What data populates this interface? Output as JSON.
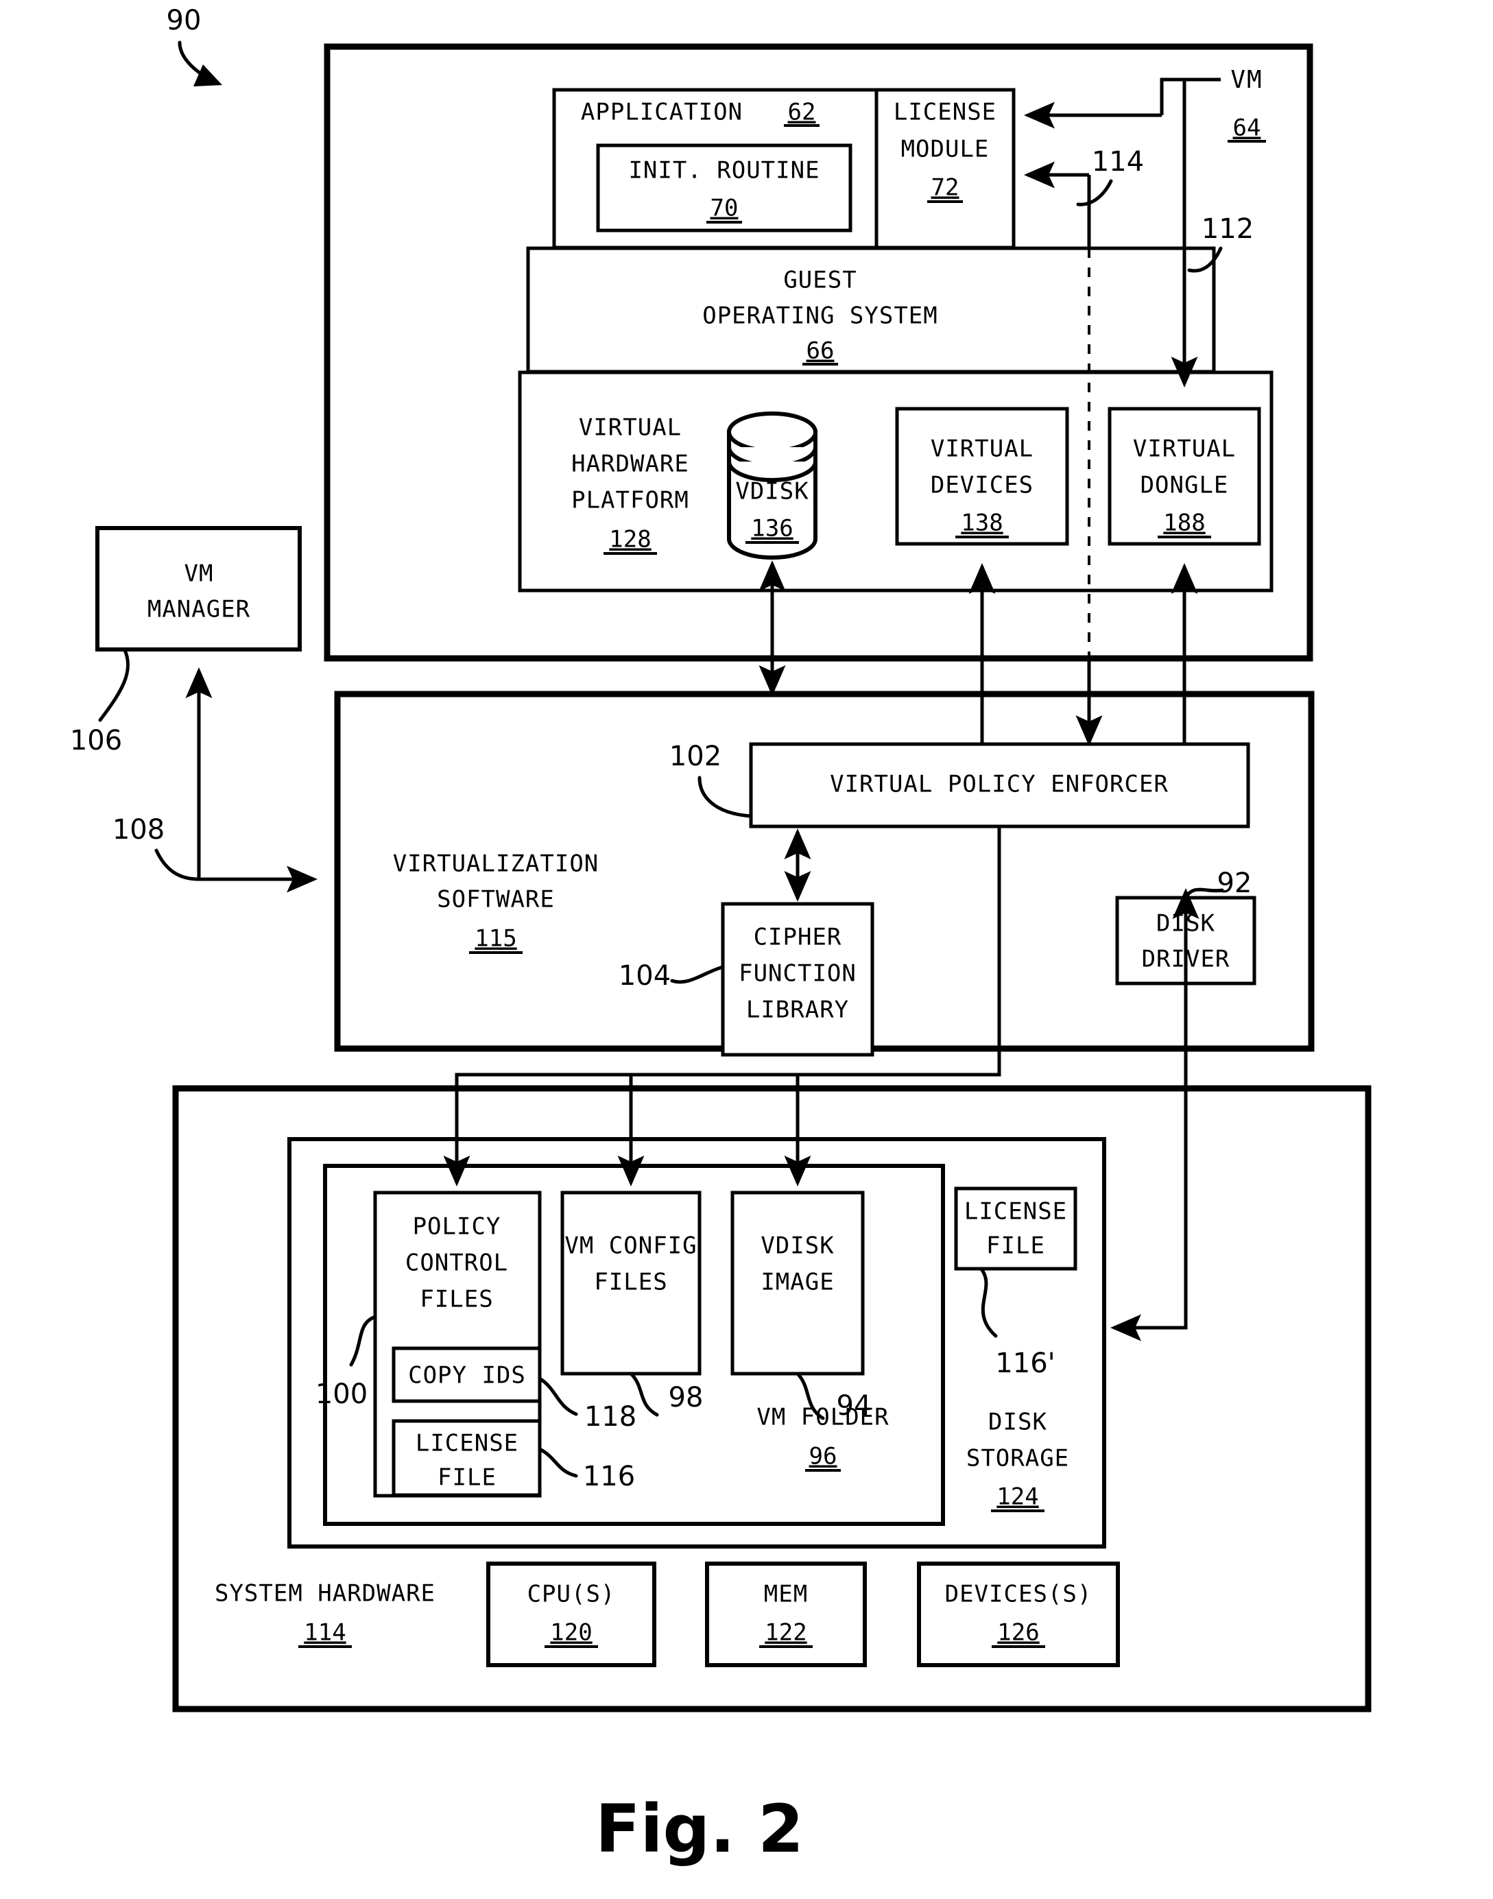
{
  "figure": {
    "caption": "Fig. 2",
    "system_ref": "90"
  },
  "vm": {
    "title": "VM",
    "ref": "64",
    "application": {
      "label": "APPLICATION",
      "ref": "62",
      "init_routine": {
        "label": "INIT. ROUTINE",
        "ref": "70"
      }
    },
    "license_module": {
      "line1": "LICENSE",
      "line2": "MODULE",
      "ref": "72"
    },
    "guest_os": {
      "line1": "GUEST",
      "line2": "OPERATING SYSTEM",
      "ref": "66"
    },
    "vhw_platform": {
      "line1": "VIRTUAL",
      "line2": "HARDWARE",
      "line3": "PLATFORM",
      "ref": "128"
    },
    "vdisk": {
      "label": "VDISK",
      "ref": "136"
    },
    "virtual_devices": {
      "line1": "VIRTUAL",
      "line2": "DEVICES",
      "ref": "138"
    },
    "virtual_dongle": {
      "line1": "VIRTUAL",
      "line2": "DONGLE",
      "ref": "188"
    },
    "arrow_refs": {
      "a114": "114",
      "a112": "112"
    }
  },
  "vm_manager": {
    "line1": "VM",
    "line2": "MANAGER",
    "ref": "106",
    "link_ref": "108"
  },
  "virtualization_software": {
    "line1": "VIRTUALIZATION",
    "line2": "SOFTWARE",
    "ref": "115",
    "virtual_policy_enforcer": {
      "label": "VIRTUAL POLICY ENFORCER",
      "ref": "102"
    },
    "cipher_function_library": {
      "line1": "CIPHER",
      "line2": "FUNCTION",
      "line3": "LIBRARY",
      "ref": "104"
    },
    "disk_driver": {
      "line1": "DISK",
      "line2": "DRIVER",
      "ref": "92"
    }
  },
  "system_hardware": {
    "label": "SYSTEM HARDWARE",
    "ref": "114",
    "cpus": {
      "label": "CPU(S)",
      "ref": "120"
    },
    "mem": {
      "label": "MEM",
      "ref": "122"
    },
    "devices": {
      "label": "DEVICES(S)",
      "ref": "126"
    }
  },
  "disk_storage": {
    "line1": "DISK",
    "line2": "STORAGE",
    "ref": "124",
    "license_file_external": {
      "line1": "LICENSE",
      "line2": "FILE",
      "ref": "116'"
    },
    "vm_folder": {
      "line1": "VM FOLDER",
      "ref": "96",
      "policy_control_files": {
        "line1": "POLICY",
        "line2": "CONTROL",
        "line3": "FILES",
        "ref": "100"
      },
      "copy_ids": {
        "label": "COPY IDS",
        "ref": "118"
      },
      "license_file": {
        "line1": "LICENSE",
        "line2": "FILE",
        "ref": "116"
      },
      "vm_config_files": {
        "line1": "VM CONFIG",
        "line2": "FILES",
        "ref": "98"
      },
      "vdisk_image": {
        "line1": "VDISK",
        "line2": "IMAGE",
        "ref": "94"
      }
    }
  }
}
